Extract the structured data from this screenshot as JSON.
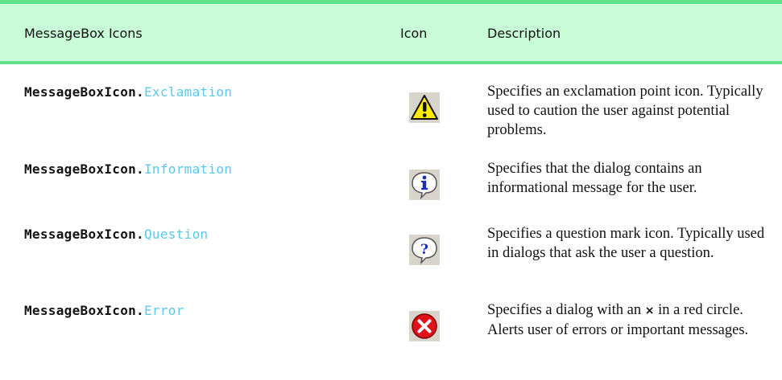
{
  "header": {
    "col1": "MessageBox Icons",
    "col2": "Icon",
    "col3": "Description"
  },
  "rows": [
    {
      "prefix": "MessageBoxIcon.",
      "member": "Exclamation",
      "icon": "warning-icon",
      "description": "Specifies an exclamation point icon. Typically used to caution the user against potential problems."
    },
    {
      "prefix": "MessageBoxIcon.",
      "member": "Information",
      "icon": "information-icon",
      "description": "Specifies that the dialog contains an informational message for the user."
    },
    {
      "prefix": "MessageBoxIcon.",
      "member": "Question",
      "icon": "question-icon",
      "description": "Specifies a question mark icon. Typically used in dialogs that ask the user a question."
    },
    {
      "prefix": "MessageBoxIcon.",
      "member": "Error",
      "icon": "error-icon",
      "description_a": "Specifies a dialog with an",
      "description_mark": "×",
      "description_b": "in a red circle. Alerts user of errors or important messages."
    }
  ],
  "colors": {
    "header_bg": "#c8fcd6",
    "header_rule": "#5fe08a",
    "member_text": "#5bc8ea",
    "error_red": "#e0101a",
    "warning_yellow": "#ffee00",
    "info_blue": "#1a2fb8"
  }
}
